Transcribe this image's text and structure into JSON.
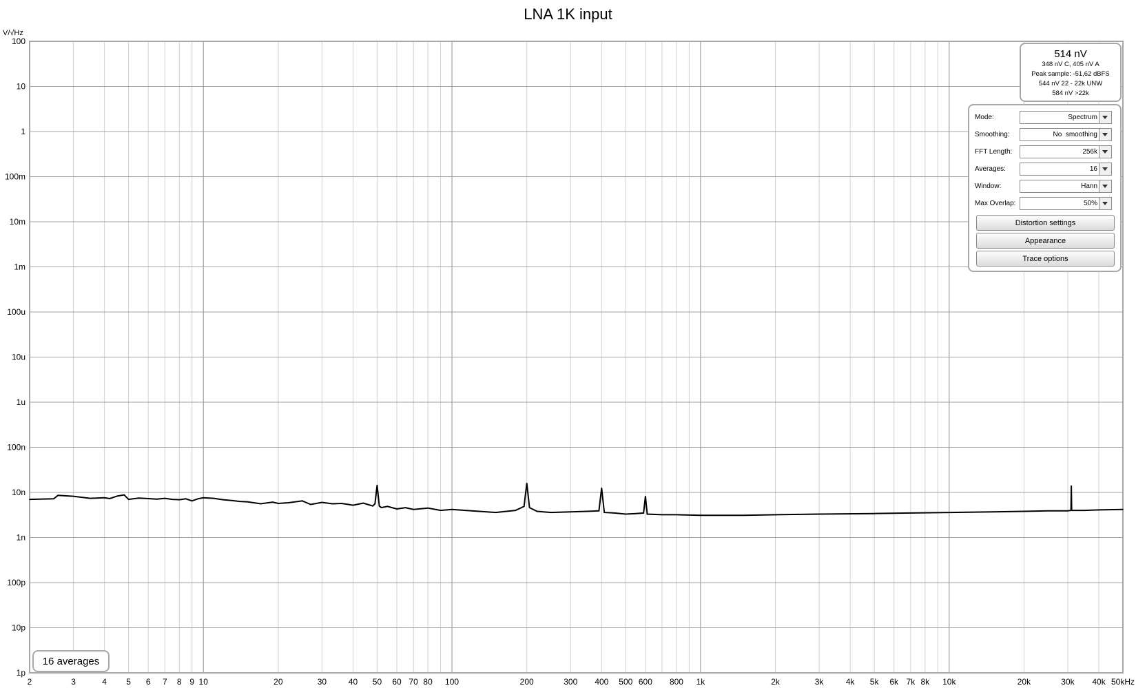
{
  "title": "LNA 1K input",
  "y_unit": "V/√Hz",
  "readout": {
    "main": "514 nV",
    "line1": "348 nV C, 405 nV A",
    "line2": "Peak sample: -51,62 dBFS",
    "line3": "544 nV 22 - 22k UNW",
    "line4": "584 nV >22k"
  },
  "controls": {
    "mode_label": "Mode:",
    "mode_value": "Spectrum",
    "smoothing_label": "Smoothing:",
    "smoothing_value": "No  smoothing",
    "fft_label": "FFT Length:",
    "fft_value": "256k",
    "averages_label": "Averages:",
    "averages_value": "16",
    "window_label": "Window:",
    "window_value": "Hann",
    "overlap_label": "Max Overlap:",
    "overlap_value": "50%",
    "distortion_button": "Distortion settings",
    "appearance_button": "Appearance",
    "trace_button": "Trace options"
  },
  "averages_badge": "16 averages",
  "colors": {
    "trace": "#000000",
    "grid_major": "#a0a0a0",
    "grid_minor": "#d0d0d0",
    "frame": "#a8a8a8"
  },
  "chart_data": {
    "type": "line",
    "title": "LNA 1K input",
    "xlabel": "",
    "ylabel": "V/√Hz",
    "x_scale": "log",
    "y_scale": "log",
    "xlim": [
      2,
      50000
    ],
    "ylim": [
      1e-12,
      100
    ],
    "grid": true,
    "x_ticks": [
      {
        "v": 2,
        "label": "2"
      },
      {
        "v": 3,
        "label": "3"
      },
      {
        "v": 4,
        "label": "4"
      },
      {
        "v": 5,
        "label": "5"
      },
      {
        "v": 6,
        "label": "6"
      },
      {
        "v": 7,
        "label": "7"
      },
      {
        "v": 8,
        "label": "8"
      },
      {
        "v": 9,
        "label": "9"
      },
      {
        "v": 10,
        "label": "10"
      },
      {
        "v": 20,
        "label": "20"
      },
      {
        "v": 30,
        "label": "30"
      },
      {
        "v": 40,
        "label": "40"
      },
      {
        "v": 50,
        "label": "50"
      },
      {
        "v": 60,
        "label": "60"
      },
      {
        "v": 70,
        "label": "70"
      },
      {
        "v": 80,
        "label": "80"
      },
      {
        "v": 100,
        "label": "100"
      },
      {
        "v": 200,
        "label": "200"
      },
      {
        "v": 300,
        "label": "300"
      },
      {
        "v": 400,
        "label": "400"
      },
      {
        "v": 500,
        "label": "500"
      },
      {
        "v": 600,
        "label": "600"
      },
      {
        "v": 800,
        "label": "800"
      },
      {
        "v": 1000,
        "label": "1k"
      },
      {
        "v": 2000,
        "label": "2k"
      },
      {
        "v": 3000,
        "label": "3k"
      },
      {
        "v": 4000,
        "label": "4k"
      },
      {
        "v": 5000,
        "label": "5k"
      },
      {
        "v": 6000,
        "label": "6k"
      },
      {
        "v": 7000,
        "label": "7k"
      },
      {
        "v": 8000,
        "label": "8k"
      },
      {
        "v": 10000,
        "label": "10k"
      },
      {
        "v": 20000,
        "label": "20k"
      },
      {
        "v": 30000,
        "label": "30k"
      },
      {
        "v": 40000,
        "label": "40k"
      },
      {
        "v": 50000,
        "label": "50kHz"
      }
    ],
    "y_ticks": [
      {
        "v": 100,
        "label": "100"
      },
      {
        "v": 10,
        "label": "10"
      },
      {
        "v": 1,
        "label": "1"
      },
      {
        "v": 0.1,
        "label": "100m"
      },
      {
        "v": 0.01,
        "label": "10m"
      },
      {
        "v": 0.001,
        "label": "1m"
      },
      {
        "v": 0.0001,
        "label": "100u"
      },
      {
        "v": 1e-05,
        "label": "10u"
      },
      {
        "v": 1e-06,
        "label": "1u"
      },
      {
        "v": 1e-07,
        "label": "100n"
      },
      {
        "v": 1e-08,
        "label": "10n"
      },
      {
        "v": 1e-09,
        "label": "1n"
      },
      {
        "v": 1e-10,
        "label": "100p"
      },
      {
        "v": 1e-11,
        "label": "10p"
      },
      {
        "v": 1e-12,
        "label": "1p"
      }
    ],
    "series": [
      {
        "name": "",
        "x": [
          2,
          2.5,
          2.6,
          3,
          3.5,
          4,
          4.2,
          4.5,
          4.8,
          5,
          5.5,
          6,
          6.5,
          7,
          7.5,
          8,
          8.5,
          9,
          9.5,
          10,
          11,
          12,
          13,
          14,
          15,
          17,
          19,
          20,
          22,
          25,
          27,
          30,
          33,
          36,
          40,
          44,
          48,
          49,
          50,
          51,
          52,
          55,
          60,
          65,
          70,
          80,
          90,
          100,
          120,
          150,
          180,
          195,
          200,
          205,
          220,
          250,
          300,
          350,
          390,
          400,
          410,
          450,
          500,
          550,
          590,
          600,
          610,
          700,
          800,
          1000,
          1500,
          2000,
          3000,
          5000,
          7000,
          10000,
          15000,
          20000,
          25000,
          30000,
          30900,
          31000,
          31100,
          35000,
          40000,
          50000
        ],
        "y": [
          7e-09,
          7.2e-09,
          8.6e-09,
          8.2e-09,
          7.4e-09,
          7.6e-09,
          7.3e-09,
          8.3e-09,
          8.8e-09,
          7e-09,
          7.5e-09,
          7.3e-09,
          7.1e-09,
          7.4e-09,
          7e-09,
          6.9e-09,
          7.2e-09,
          6.5e-09,
          7.2e-09,
          7.6e-09,
          7.4e-09,
          6.9e-09,
          6.6e-09,
          6.3e-09,
          6.2e-09,
          5.6e-09,
          6.1e-09,
          5.7e-09,
          5.9e-09,
          6.5e-09,
          5.4e-09,
          6e-09,
          5.6e-09,
          5.7e-09,
          5.2e-09,
          5.8e-09,
          5e-09,
          5.6e-09,
          1.45e-08,
          5e-09,
          4.6e-09,
          4.9e-09,
          4.3e-09,
          4.6e-09,
          4.2e-09,
          4.5e-09,
          4e-09,
          4.2e-09,
          3.9e-09,
          3.6e-09,
          4e-09,
          4.9e-09,
          1.6e-08,
          4.6e-09,
          3.8e-09,
          3.6e-09,
          3.7e-09,
          3.8e-09,
          3.9e-09,
          1.25e-08,
          3.6e-09,
          3.5e-09,
          3.3e-09,
          3.4e-09,
          3.5e-09,
          8.2e-09,
          3.3e-09,
          3.2e-09,
          3.2e-09,
          3.1e-09,
          3.1e-09,
          3.2e-09,
          3.3e-09,
          3.4e-09,
          3.5e-09,
          3.6e-09,
          3.7e-09,
          3.8e-09,
          3.9e-09,
          3.9e-09,
          4e-09,
          1.4e-08,
          4e-09,
          4e-09,
          4.1e-09,
          4.2e-09
        ]
      }
    ]
  }
}
